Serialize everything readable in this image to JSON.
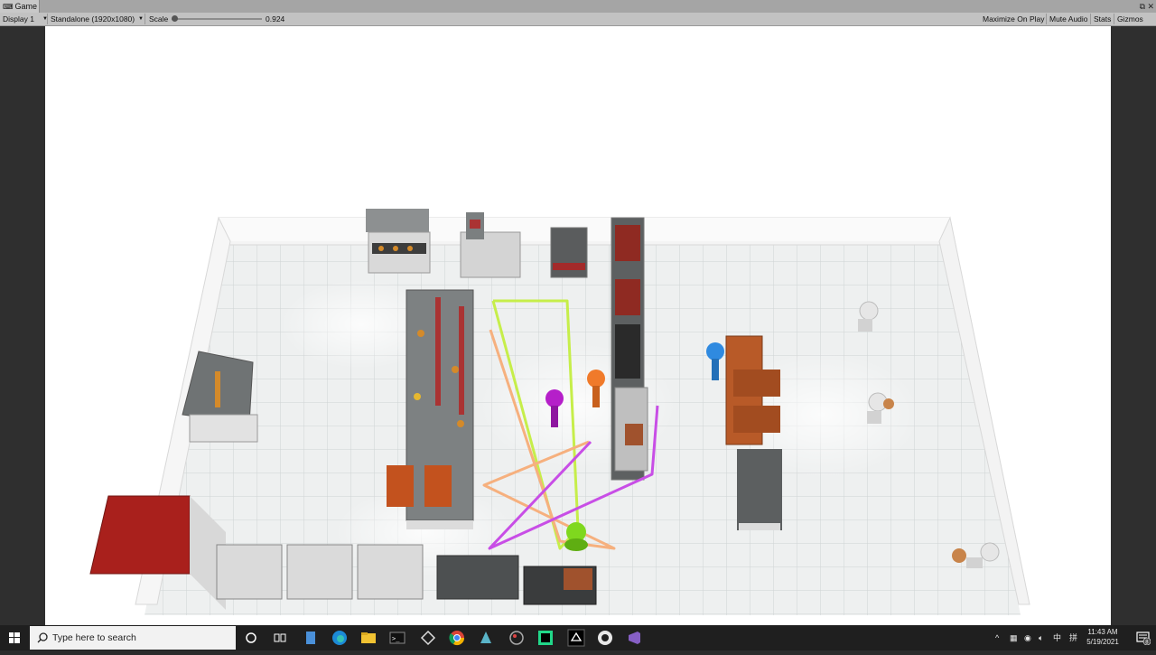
{
  "window": {
    "tab_label": "Game",
    "tab_icon": "game-controller-icon",
    "controls": [
      "⧉",
      "✕"
    ]
  },
  "toolbar": {
    "display": "Display 1",
    "resolution": "Standalone (1920x1080)",
    "scale_label": "Scale",
    "scale_value": "0.924",
    "maximize_on_play": "Maximize On Play",
    "mute_audio": "Mute Audio",
    "stats": "Stats",
    "gizmos": "Gizmos"
  },
  "scene": {
    "description_free": true,
    "agent_colors": {
      "green": "#7fd81e",
      "purple": "#b51fc9",
      "orange": "#f07a2a",
      "blue": "#2f8ae0",
      "white": "#e6e6e6"
    },
    "path_colors": {
      "lime": "#c6ee4a",
      "peach": "#f6b07e",
      "magenta": "#c84ee6"
    }
  },
  "taskbar": {
    "search_placeholder": "Type here to search",
    "time": "11:43 AM",
    "date": "5/19/2021",
    "ime_label": "中",
    "ime_label2": "拼",
    "notification_count": "8",
    "pinned": [
      "cortana-icon",
      "task-view-icon",
      "file-icon",
      "edge-icon",
      "folder-icon",
      "terminal-icon",
      "unity-hub-icon",
      "chrome-icon",
      "app-icon",
      "paint-icon",
      "pycharm-icon",
      "unity-icon",
      "github-icon",
      "visual-studio-icon"
    ]
  }
}
